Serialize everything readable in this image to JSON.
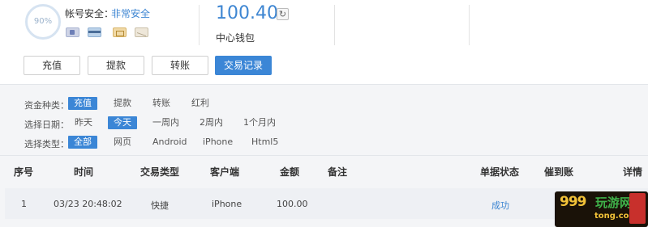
{
  "account": {
    "progress_text": "90%",
    "security_label": "帐号安全：",
    "security_value": "非常安全",
    "bind_icons": [
      "id-card-icon",
      "bank-card-icon",
      "sim-card-icon",
      "email-icon"
    ]
  },
  "wallet": {
    "balance": "100.40",
    "label": "中心钱包",
    "refresh_icon": "refresh-icon"
  },
  "actions": [
    {
      "label": "充值",
      "active": false
    },
    {
      "label": "提款",
      "active": false
    },
    {
      "label": "转账",
      "active": false
    },
    {
      "label": "交易记录",
      "active": true
    }
  ],
  "filters": {
    "fund_type": {
      "label": "资金种类：",
      "options": [
        "充值",
        "提款",
        "转账",
        "红利"
      ],
      "selected": "充值"
    },
    "date": {
      "label": "选择日期：",
      "options": [
        "昨天",
        "今天",
        "一周内",
        "2周内",
        "1个月内"
      ],
      "selected": "今天"
    },
    "client_type": {
      "label": "选择类型：",
      "options": [
        "全部",
        "网页",
        "Android",
        "iPhone",
        "Html5"
      ],
      "selected": "全部"
    }
  },
  "table": {
    "headers": [
      "序号",
      "时间",
      "交易类型",
      "客户端",
      "金额",
      "备注",
      "单据状态",
      "催到账",
      "详情"
    ],
    "rows": [
      {
        "index": "1",
        "time": "03/23 20:48:02",
        "type": "快捷",
        "client": "iPhone",
        "amount": "100.00",
        "note": "",
        "status": "成功",
        "urge": "",
        "detail": ""
      }
    ]
  },
  "watermark": {
    "line1": "999",
    "line2": "玩游网",
    "line3": "tong.com",
    "badge": "万众"
  },
  "colors": {
    "accent": "#3b86d6",
    "panel_bg": "#f4f5f7",
    "row_bg": "#eef0f4"
  }
}
